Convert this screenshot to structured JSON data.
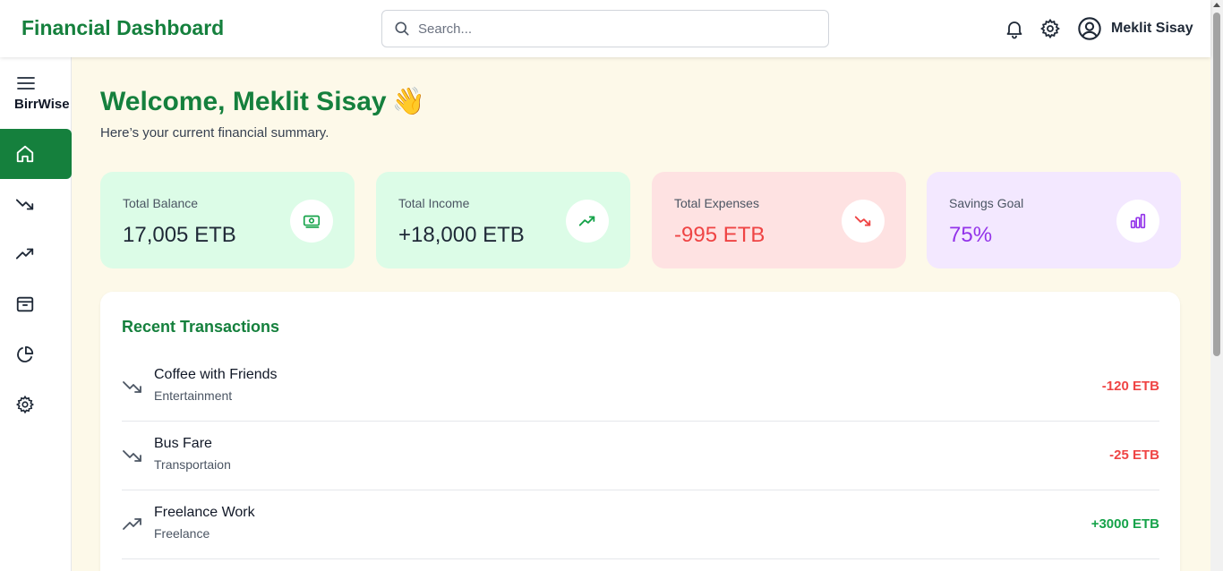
{
  "header": {
    "title": "Financial Dashboard",
    "search_placeholder": "Search...",
    "icons": [
      "bell-icon",
      "gear-icon",
      "user-circle-icon"
    ],
    "user_name": "Meklit Sisay"
  },
  "sidebar": {
    "brand": "BirrWise",
    "items": [
      {
        "name": "home",
        "icon": "home-icon",
        "active": true
      },
      {
        "name": "expenses",
        "icon": "trending-down-icon",
        "active": false
      },
      {
        "name": "income",
        "icon": "trending-up-icon",
        "active": false
      },
      {
        "name": "budget",
        "icon": "archive-icon",
        "active": false
      },
      {
        "name": "reports",
        "icon": "pie-chart-icon",
        "active": false
      },
      {
        "name": "settings",
        "icon": "gear-icon",
        "active": false
      }
    ]
  },
  "welcome": {
    "heading": "Welcome, Meklit Sisay",
    "emoji": "👋",
    "subtitle": "Here’s your current financial summary."
  },
  "cards": [
    {
      "label": "Total Balance",
      "value": "17,005 ETB",
      "icon": "banknote-icon",
      "bg": "#dcfce7",
      "color": "#1f2937"
    },
    {
      "label": "Total Income",
      "value": "+18,000 ETB",
      "icon": "trending-up-icon",
      "bg": "#dcfce7",
      "color": "#1f2937"
    },
    {
      "label": "Total Expenses",
      "value": "-995 ETB",
      "icon": "trending-down-icon",
      "bg": "#fee2e2",
      "color": "#ef4444"
    },
    {
      "label": "Savings Goal",
      "value": "75%",
      "icon": "bar-chart-icon",
      "bg": "#f3e8ff",
      "color": "#9333ea"
    }
  ],
  "transactions": {
    "title": "Recent Transactions",
    "rows": [
      {
        "name": "Coffee with Friends",
        "category": "Entertainment",
        "amount": "-120 ETB",
        "type": "expense"
      },
      {
        "name": "Bus Fare",
        "category": "Transportaion",
        "amount": "-25 ETB",
        "type": "expense"
      },
      {
        "name": "Freelance Work",
        "category": "Freelance",
        "amount": "+3000 ETB",
        "type": "income"
      }
    ]
  },
  "colors": {
    "brand_green": "#15803d",
    "expense_red": "#ef4444",
    "income_green": "#16a34a",
    "savings_purple": "#9333ea",
    "page_bg": "#fdf9e9"
  }
}
